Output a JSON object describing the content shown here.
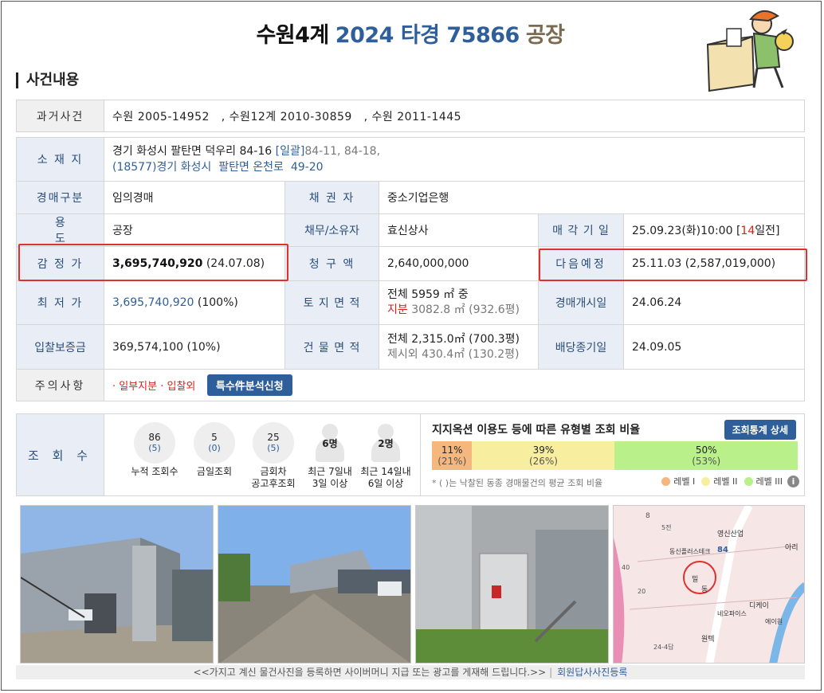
{
  "header": {
    "court": "수원4계",
    "case_no": "2024 타경 75866",
    "kind": "공장"
  },
  "section_title": "사건내용",
  "rows": {
    "past_cases": {
      "label": "과거사건",
      "value": "수원 2005-14952   , 수원12계 2010-30859   , 수원 2011-1445"
    },
    "location": {
      "label": "소 재 지",
      "line1": "경기 화성시 팔탄면 덕우리 84-16",
      "bulk_tag": "[일괄]",
      "bulk_rest": "84-11, 84-18,",
      "line2": "(18577)경기 화성시  팔탄면 온천로  49-20"
    },
    "auction_type": {
      "label": "경매구분",
      "value": "임의경매"
    },
    "creditor": {
      "label": "채 권 자",
      "value": "중소기업은행"
    },
    "usage": {
      "label": "용 도",
      "value": "공장"
    },
    "debtor": {
      "label": "채무/소유자",
      "value": "효신상사"
    },
    "sale_date": {
      "label": "매 각 기 일",
      "value_pre": "25.09.23(화)10:00 [",
      "value_days": "14",
      "value_post": "일전]"
    },
    "appraisal": {
      "label": "감 정 가",
      "amount": "3,695,740,920",
      "date": " (24.07.08)"
    },
    "claim": {
      "label": "청 구 액",
      "value": "2,640,000,000"
    },
    "next_schedule": {
      "label": "다음예정",
      "value": "25.11.03 (2,587,019,000)"
    },
    "minimum": {
      "label": "최 저 가",
      "amount": "3,695,740,920",
      "pct": " (100%)"
    },
    "land_area": {
      "label": "토 지 면 적",
      "line1": "전체 5959 ㎡ 중",
      "line2_tag": "지분",
      "line2_rest": " 3082.8 ㎡ (932.6평)"
    },
    "auction_start": {
      "label": "경매개시일",
      "value": "24.06.24"
    },
    "deposit": {
      "label": "입찰보증금",
      "value": "369,574,100 (10%)"
    },
    "building_area": {
      "label": "건 물 면 적",
      "line1": "전체 2,315.0㎡ (700.3평)",
      "line2": "제시외 430.4㎡ (130.2평)"
    },
    "dividend_end": {
      "label": "배당종기일",
      "value": "24.09.05"
    },
    "caution": {
      "label": "주의사항",
      "value": "· 일부지분 · 입찰외",
      "button": "특수件분석신청"
    }
  },
  "views": {
    "label": "조 회 수",
    "items": [
      {
        "count": "86",
        "sub": "(5)",
        "caption1": "누적 조회수",
        "caption2": ""
      },
      {
        "count": "5",
        "sub": "(0)",
        "caption1": "금일조회",
        "caption2": ""
      },
      {
        "count": "25",
        "sub": "(5)",
        "caption1": "금회차",
        "caption2": "공고후조회"
      },
      {
        "count": "6명",
        "sub": "",
        "caption1": "최근 7일내",
        "caption2": "3일 이상"
      },
      {
        "count": "2명",
        "sub": "",
        "caption1": "최근 14일내",
        "caption2": "6일 이상"
      }
    ]
  },
  "ratio": {
    "title": "지지옥션 이용도 등에 따른 유형별 조회 비율",
    "button": "조회통계 상세",
    "segments": [
      {
        "pct": "11%",
        "avg": "(21%)",
        "value": 11,
        "color": "#f4b77e"
      },
      {
        "pct": "39%",
        "avg": "(26%)",
        "value": 39,
        "color": "#f7ef9f"
      },
      {
        "pct": "50%",
        "avg": "(53%)",
        "value": 50,
        "color": "#b9f08a"
      }
    ],
    "note": "* ( )는 낙찰된 동종 경매물건의 평균 조회 비율",
    "legend": [
      {
        "label": "레벨 I",
        "color": "#f4b77e"
      },
      {
        "label": "레벨 II",
        "color": "#f7ef9f"
      },
      {
        "label": "레벨 III",
        "color": "#b9f08a"
      }
    ]
  },
  "map_labels": [
    "8",
    "84",
    "영신산업",
    "동신플러스테크",
    "밀",
    "동",
    "원텍",
    "디케이",
    "네오파이스",
    "아리",
    "에이원",
    "40",
    "5전",
    "20",
    "24-4답"
  ],
  "footer": {
    "text": "<<가지고 계신 물건사진을 등록하면 사이버머니 지급 또는 광고를 게재해 드립니다.>>",
    "link": "회원답사사진등록"
  }
}
